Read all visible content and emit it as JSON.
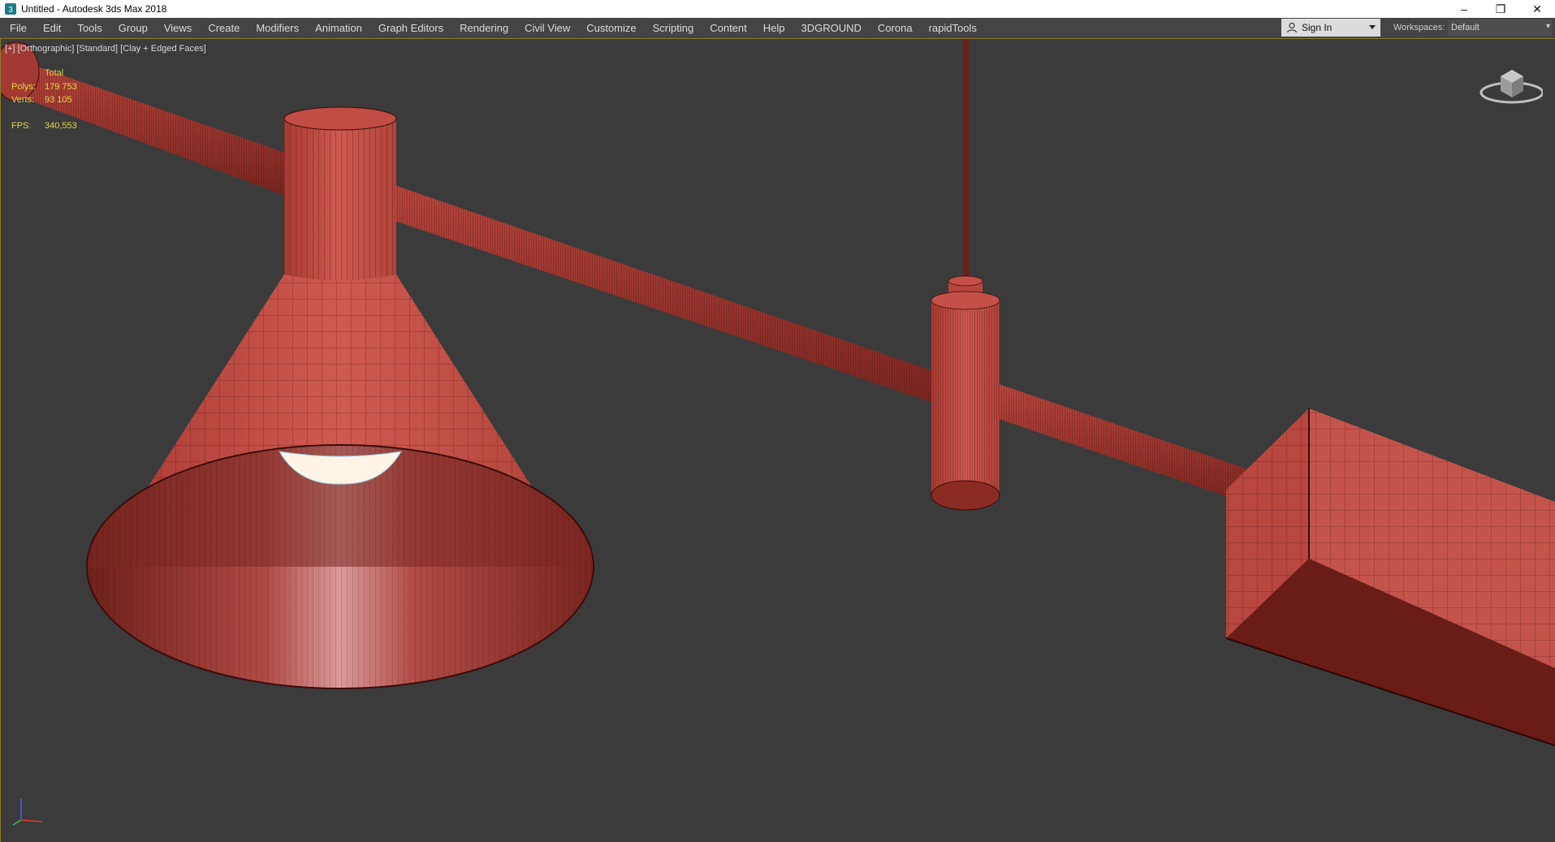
{
  "window": {
    "title": "Untitled - Autodesk 3ds Max 2018",
    "controls": {
      "minimize": "–",
      "restore": "❐",
      "close": "✕"
    }
  },
  "menubar": {
    "items": [
      "File",
      "Edit",
      "Tools",
      "Group",
      "Views",
      "Create",
      "Modifiers",
      "Animation",
      "Graph Editors",
      "Rendering",
      "Civil View",
      "Customize",
      "Scripting",
      "Content",
      "Help",
      "3DGROUND",
      "Corona",
      "rapidTools"
    ],
    "signin": {
      "label": "Sign In",
      "icon": "user-icon"
    },
    "workspaces": {
      "label": "Workspaces:",
      "value": "Default"
    }
  },
  "viewport": {
    "label": "[+] [Orthographic] [Standard] [Clay + Edged Faces]",
    "stats": {
      "total_label": "Total",
      "polys_label": "Polys:",
      "polys_value": "179 753",
      "verts_label": "Verts:",
      "verts_value": "93 105",
      "fps_label": "FPS:",
      "fps_value": "340,553"
    }
  },
  "colors": {
    "viewport_bg": "#3b3b3b",
    "menubar_bg": "#444444",
    "model_fill": "#c25148",
    "model_dark": "#5a1b17",
    "wire": "#3a0d0b",
    "stats_text": "#e5d544",
    "bulb": "#fff4e6"
  }
}
